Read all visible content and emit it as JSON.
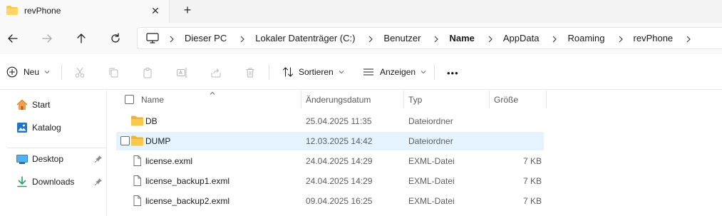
{
  "window": {
    "tab_title": "revPhone",
    "tab_close": "✕",
    "new_tab": "+"
  },
  "address_bar": {
    "crumbs": [
      {
        "label": "Dieser PC"
      },
      {
        "label": "Lokaler Datenträger (C:)"
      },
      {
        "label": "Benutzer"
      },
      {
        "label": "Name"
      },
      {
        "label": "AppData"
      },
      {
        "label": "Roaming"
      },
      {
        "label": "revPhone"
      }
    ]
  },
  "toolbar": {
    "new_label": "Neu",
    "sort_label": "Sortieren",
    "view_label": "Anzeigen",
    "more_label": "•••",
    "disabled_icons": [
      "cut-icon",
      "copy-icon",
      "paste-icon",
      "rename-icon",
      "share-icon",
      "delete-icon"
    ]
  },
  "sidebar": {
    "items": [
      {
        "label": "Start",
        "icon": "home-icon"
      },
      {
        "label": "Katalog",
        "icon": "gallery-icon"
      },
      {
        "label": "Desktop",
        "icon": "desktop-icon",
        "pinned": true
      },
      {
        "label": "Downloads",
        "icon": "download-icon",
        "pinned": true
      }
    ]
  },
  "file_list": {
    "columns": [
      "Name",
      "Änderungsdatum",
      "Typ",
      "Größe"
    ],
    "rows": [
      {
        "name": "DB",
        "modified": "25.04.2025 11:35",
        "type": "Dateiordner",
        "size": "",
        "icon": "folder-icon"
      },
      {
        "name": "DUMP",
        "modified": "12.03.2025 14:42",
        "type": "Dateiordner",
        "size": "",
        "icon": "folder-icon",
        "hovered": true
      },
      {
        "name": "license.exml",
        "modified": "24.04.2025 14:29",
        "type": "EXML-Datei",
        "size": "7 KB",
        "icon": "file-icon"
      },
      {
        "name": "license_backup1.exml",
        "modified": "24.04.2025 14:29",
        "type": "EXML-Datei",
        "size": "7 KB",
        "icon": "file-icon"
      },
      {
        "name": "license_backup2.exml",
        "modified": "09.04.2025 16:25",
        "type": "EXML-Datei",
        "size": "7 KB",
        "icon": "file-icon"
      }
    ]
  },
  "colors": {
    "folder": "#f8c94a",
    "hover_row": "#e5f3ff",
    "accent": "#0067c0"
  }
}
